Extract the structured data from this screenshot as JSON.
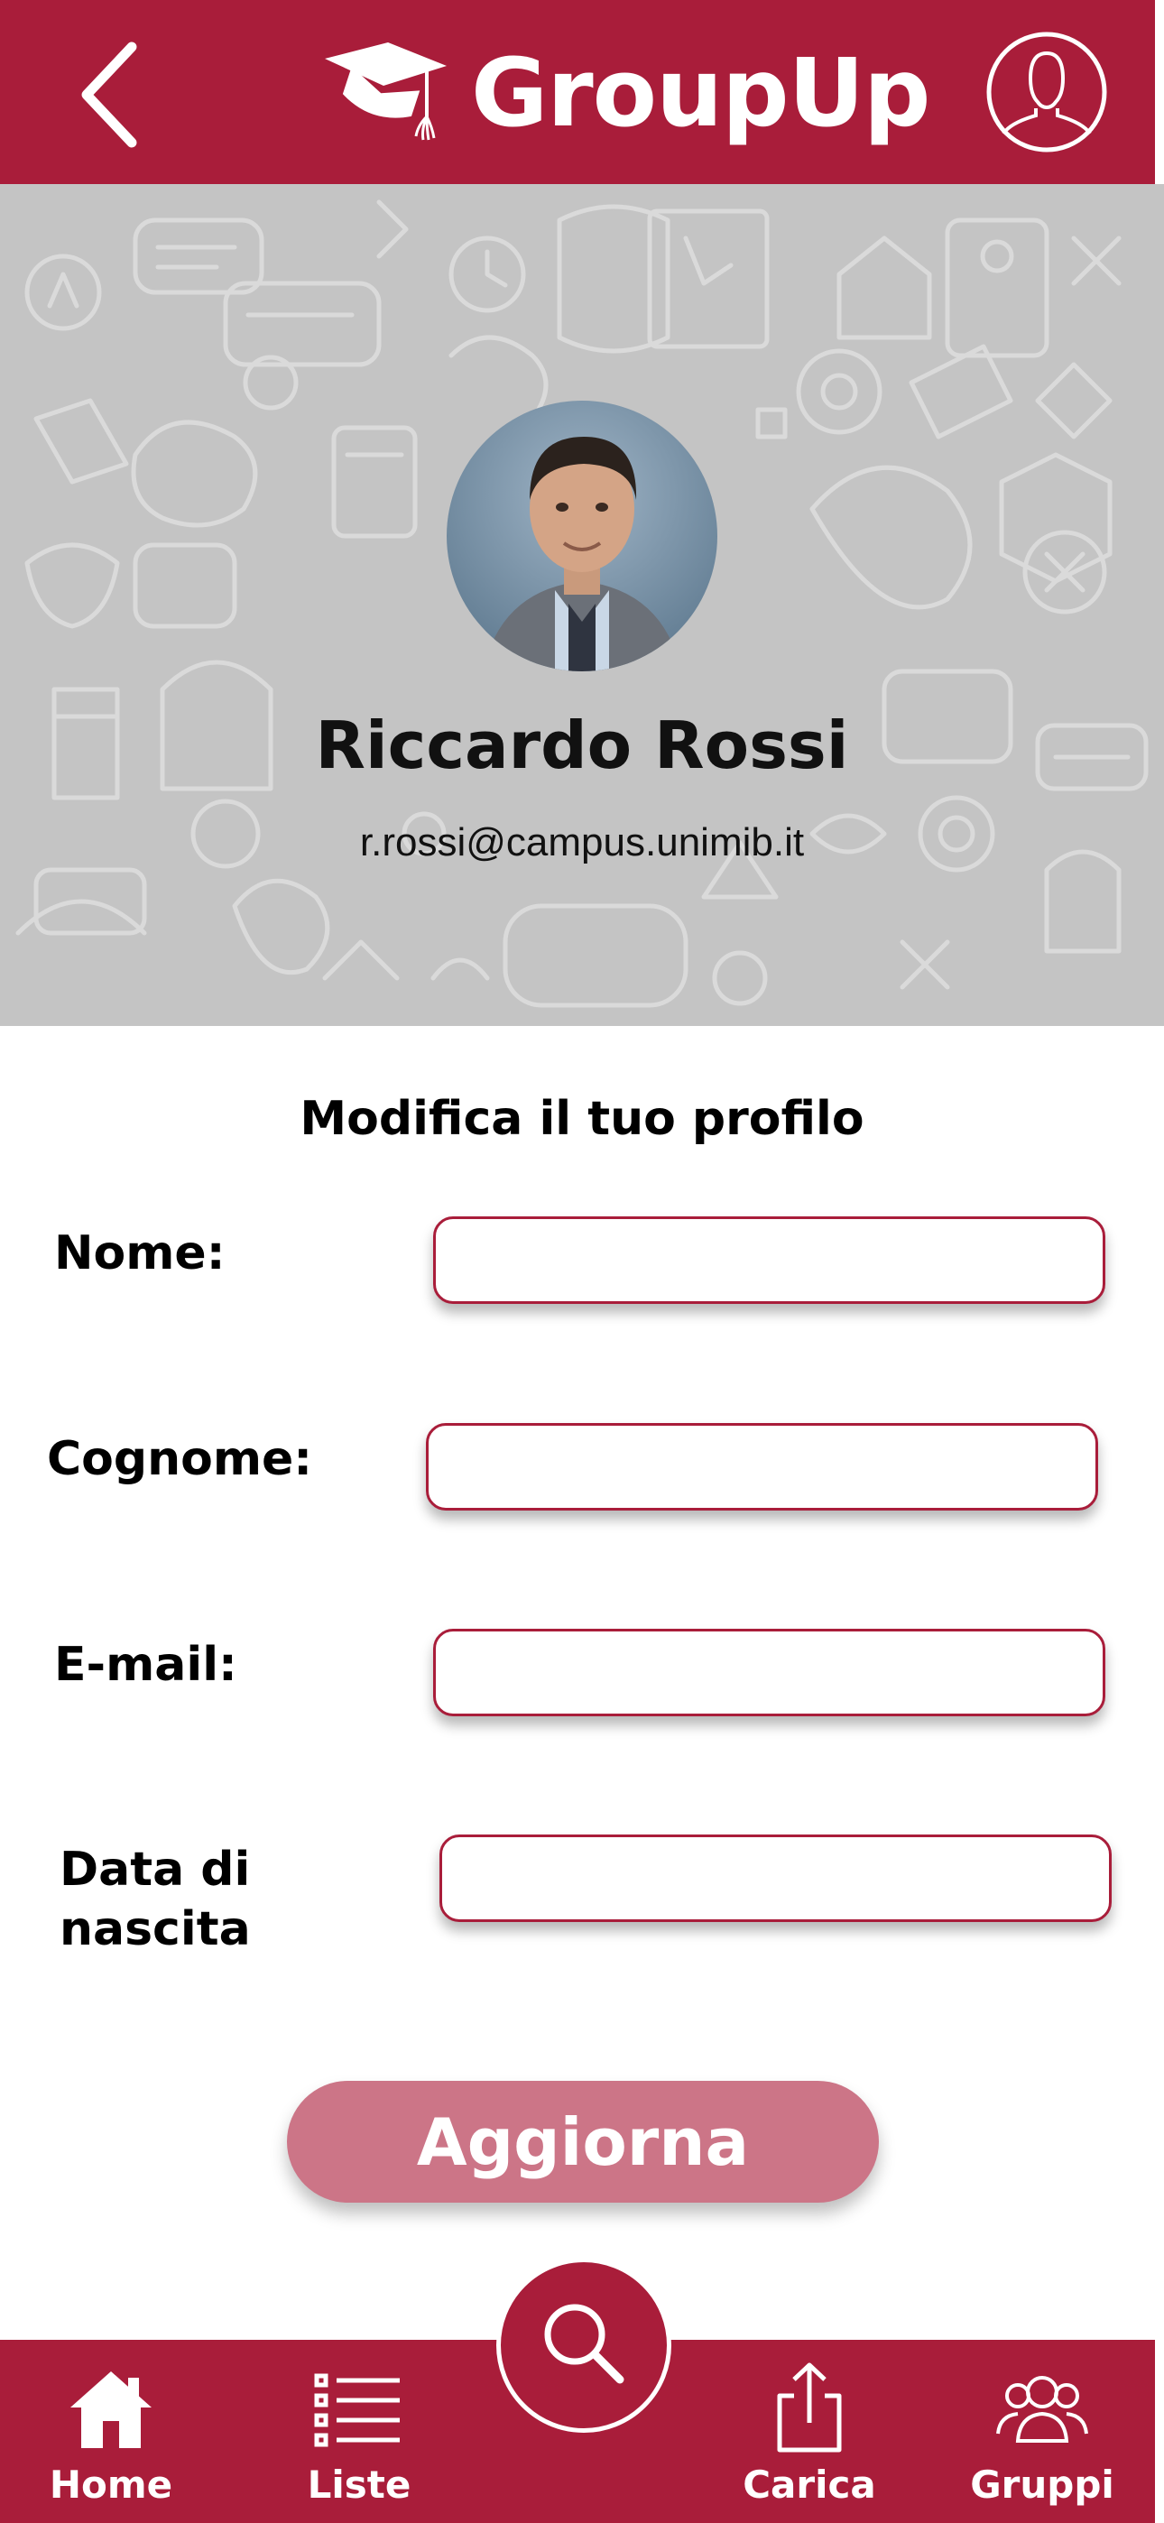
{
  "app": {
    "title": "GroupUp"
  },
  "profile": {
    "name": "Riccardo Rossi",
    "email": "r.rossi@campus.unimib.it"
  },
  "form": {
    "title": "Modifica il tuo profilo",
    "fields": [
      {
        "label": "Nome:",
        "value": "",
        "placeholder": ""
      },
      {
        "label": "Cognome:",
        "value": "",
        "placeholder": ""
      },
      {
        "label": "E-mail:",
        "value": "",
        "placeholder": ""
      },
      {
        "label_line1": "Data di",
        "label_line2": "nascita",
        "value": "",
        "placeholder": ""
      }
    ],
    "submit_label": "Aggiorna"
  },
  "nav": {
    "items": [
      {
        "label": "Home",
        "icon": "home-icon"
      },
      {
        "label": "Liste",
        "icon": "list-icon"
      },
      {
        "label": "Carica",
        "icon": "upload-icon"
      },
      {
        "label": "Gruppi",
        "icon": "group-icon"
      }
    ],
    "search_icon": "search-icon"
  },
  "colors": {
    "brand": "#a91d3a",
    "button": "#cc7587",
    "cover_background": "#c4c4c4"
  }
}
